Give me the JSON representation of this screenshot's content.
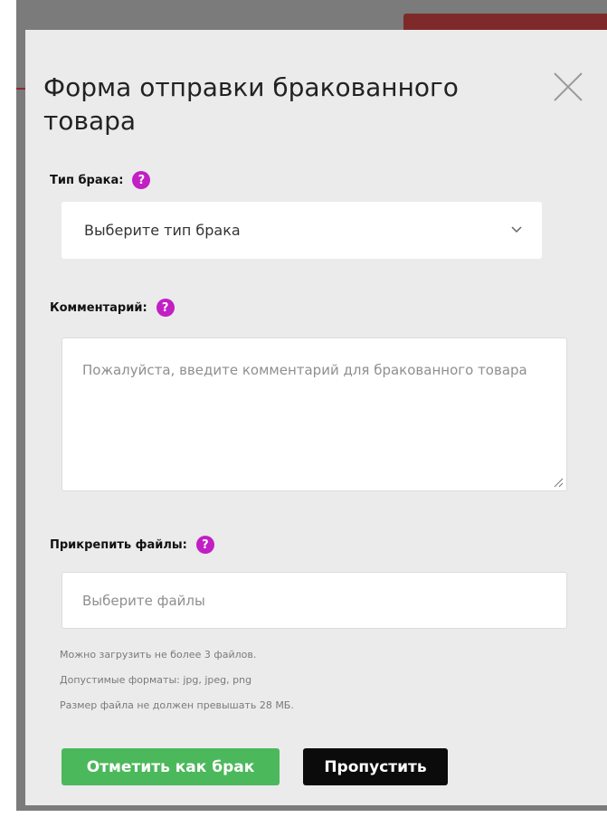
{
  "modal": {
    "title": "Форма отправки бракованного товара",
    "close_icon": "close-icon"
  },
  "defect_type": {
    "label": "Тип брака:",
    "help_icon": "?",
    "select": {
      "selected": "Выберите тип брака"
    }
  },
  "comment": {
    "label": "Комментарий:",
    "help_icon": "?",
    "placeholder": "Пожалуйста, введите комментарий для бракованного товара"
  },
  "attachments": {
    "label": "Прикрепить файлы:",
    "help_icon": "?",
    "placeholder": "Выберите файлы",
    "hints": [
      "Можно загрузить не более 3 файлов.",
      "Допустимые форматы: jpg, jpeg, png",
      "Размер файла не должен превышать 28 МБ."
    ]
  },
  "actions": {
    "mark_defect_label": "Отметить как брак",
    "skip_label": "Пропустить"
  },
  "colors": {
    "help_badge": "#c21fc4",
    "primary_green": "#4cb85c",
    "secondary_black": "#0b0b0b",
    "modal_bg": "#ebebeb",
    "backdrop": "#7b7b7b"
  }
}
